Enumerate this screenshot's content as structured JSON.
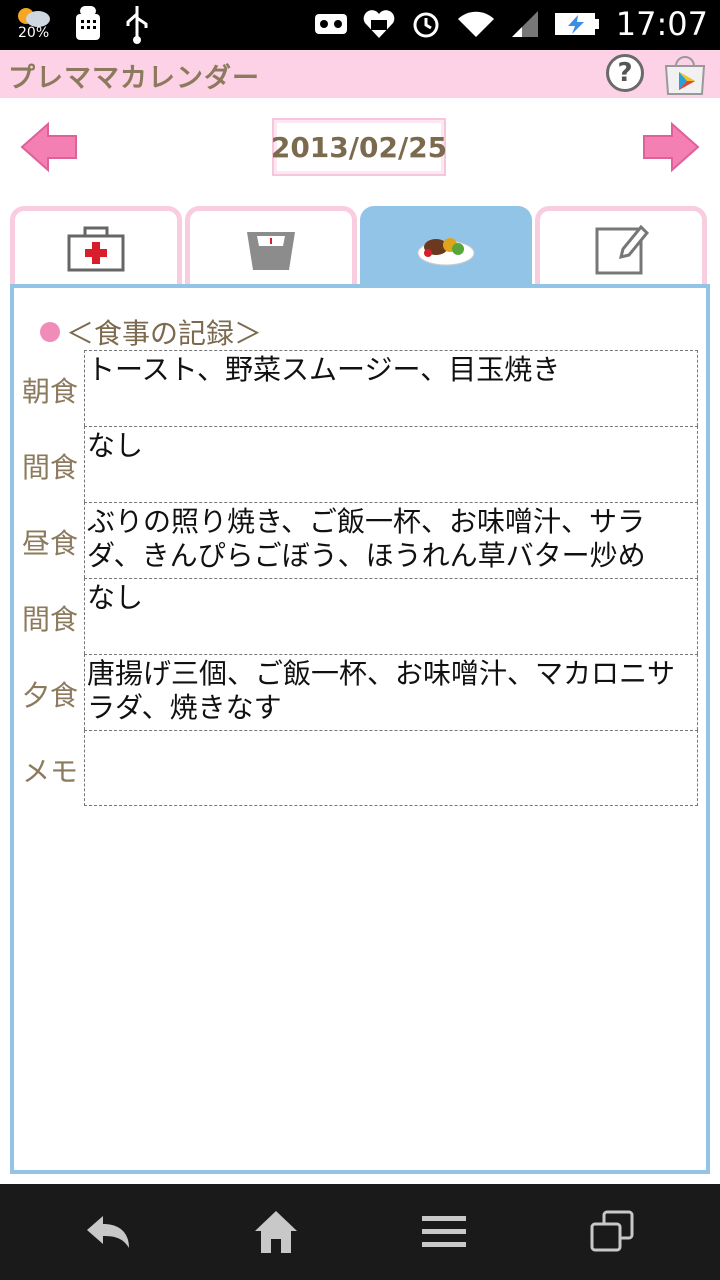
{
  "status_bar": {
    "battery_percent": "20%",
    "time": "17:07"
  },
  "app": {
    "title": "プレママカレンダー",
    "help_label": "?"
  },
  "date_nav": {
    "date": "2013/02/25"
  },
  "tabs": [
    {
      "name": "health",
      "icon": "first-aid-icon"
    },
    {
      "name": "weight",
      "icon": "scale-icon"
    },
    {
      "name": "meal",
      "icon": "food-plate-icon",
      "active": true
    },
    {
      "name": "memo",
      "icon": "notepad-icon"
    }
  ],
  "meal": {
    "section_title": "＜食事の記録＞",
    "rows": [
      {
        "label": "朝食",
        "value": "トースト、野菜スムージー、目玉焼き"
      },
      {
        "label": "間食",
        "value": "なし"
      },
      {
        "label": "昼食",
        "value": "ぶりの照り焼き、ご飯一杯、お味噌汁、サラダ、きんぴらごぼう、ほうれん草バター炒め"
      },
      {
        "label": "間食",
        "value": "なし"
      },
      {
        "label": "夕食",
        "value": "唐揚げ三個、ご飯一杯、お味噌汁、マカロニサラダ、焼きなす"
      },
      {
        "label": "メモ",
        "value": ""
      }
    ]
  },
  "colors": {
    "title_bar_bg": "#fdd2e6",
    "accent_blue": "#92c4e8",
    "arrow_pink": "#f47fb3",
    "label_brown": "#8c7a5e"
  }
}
